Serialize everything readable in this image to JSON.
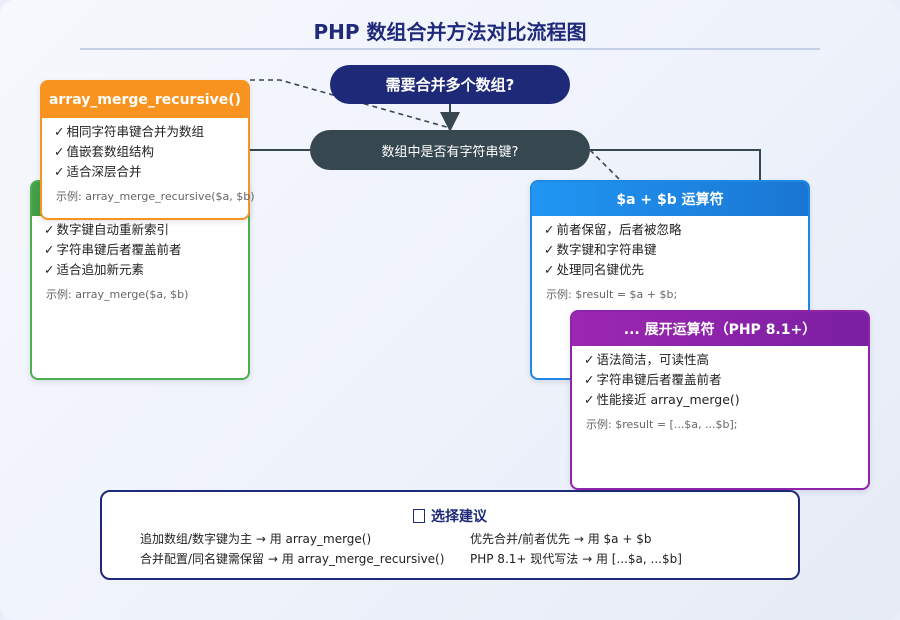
{
  "title": "PHP 数组合并方法对比流程图",
  "question1": "需要合并多个数组?",
  "question2": "数组中是否有字符串键?",
  "cards": {
    "merge": {
      "header": "",
      "items": [
        "数字键自动重新索引",
        "字符串键后者覆盖前者",
        "适合追加新元素"
      ],
      "example": "示例: array_merge($a, $b)"
    },
    "recursive": {
      "header": "array_merge_recursive()",
      "items": [
        "相同字符串键合并为数组",
        "值嵌套数组结构",
        "适合深层合并"
      ],
      "example": "示例: array_merge_recursive($a, $b)"
    },
    "plus": {
      "header": "$a + $b 运算符",
      "items": [
        "前者保留，后者被忽略",
        "数字键和字符串键",
        "处理同名键优先"
      ],
      "example": "示例: $result = $a + $b;"
    },
    "spread": {
      "header": "... 展开运算符（PHP 8.1+）",
      "items": [
        "语法简洁，可读性高",
        "字符串键后者覆盖前者",
        "性能接近 array_merge()"
      ],
      "example": "示例: $result = [...$a, ...$b];"
    }
  },
  "check_mark": "✓",
  "advice": {
    "title": "选择建议",
    "tips": [
      "追加数组/数字键为主 → 用 array_merge()",
      "优先合并/前者优先 → 用 $a + $b",
      "合并配置/同名键需保留 → 用 array_merge_recursive()",
      "PHP 8.1+ 现代写法 → 用 [...$a, ...$b]"
    ]
  },
  "colors": {
    "navy": "#1e2a78",
    "slate": "#37474f",
    "green": "#43a047",
    "orange": "#f7931e",
    "blue": "#1e88e5",
    "purple": "#8e24aa"
  }
}
